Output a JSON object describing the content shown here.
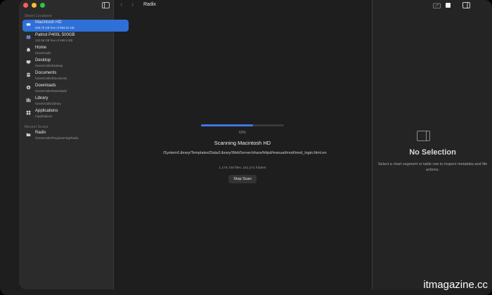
{
  "sidebar": {
    "section_locations": "Smart Locations",
    "section_recent": "Recent Scans",
    "items": [
      {
        "name": "Macintosh HD",
        "sub": "536.76 GB free of 994.61 GB",
        "icon": "drive-icon"
      },
      {
        "name": "Patriot P400L 500GB",
        "sub": "142.55 GB free of 499.9 GB",
        "icon": "external-drive-icon"
      },
      {
        "name": "Home",
        "sub": "/Users/colin",
        "icon": "home-icon"
      },
      {
        "name": "Desktop",
        "sub": "/Users/colin/Desktop",
        "icon": "desktop-icon"
      },
      {
        "name": "Documents",
        "sub": "/Users/colin/Documents",
        "icon": "document-icon"
      },
      {
        "name": "Downloads",
        "sub": "/Users/colin/Downloads",
        "icon": "download-icon"
      },
      {
        "name": "Library",
        "sub": "/Users/colin/Library",
        "icon": "library-icon"
      },
      {
        "name": "Applications",
        "sub": "/Applications",
        "icon": "grid-icon"
      }
    ],
    "recent": [
      {
        "name": "Radix",
        "sub": "/Users/colin/Programming/Radix",
        "icon": "folder-icon"
      }
    ]
  },
  "toolbar": {
    "title": "Radix"
  },
  "scan": {
    "percent_label": "63%",
    "progress": 0.63,
    "title": "Scanning Macintosh HD",
    "path": "/System/Library/Templates/Data/Library/WebServer/share/httpd/manual/mod/mod_logio.html.en",
    "counts": "1,176,729 files, 181,271 folders",
    "stop_label": "Stop Scan"
  },
  "inspector": {
    "title": "No Selection",
    "hint": "Select a chart segment or table row to inspect metadata and file actions."
  },
  "watermark": "itmagazine.cc",
  "colors": {
    "accent": "#2f6fd8",
    "progress": "#3f78e6"
  }
}
